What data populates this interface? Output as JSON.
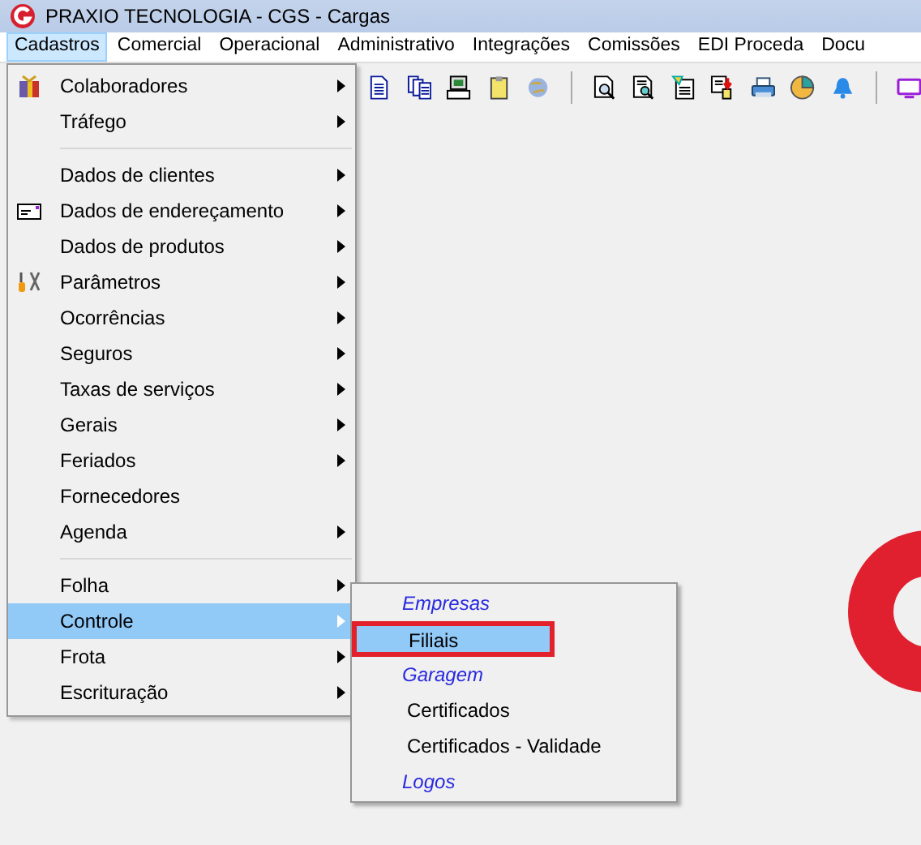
{
  "window": {
    "title": "PRAXIO TECNOLOGIA - CGS - Cargas"
  },
  "menu_bar": [
    {
      "label": "Cadastros",
      "selected": true
    },
    {
      "label": "Comercial",
      "selected": false
    },
    {
      "label": "Operacional",
      "selected": false
    },
    {
      "label": "Administrativo",
      "selected": false
    },
    {
      "label": "Integrações",
      "selected": false
    },
    {
      "label": "Comissões",
      "selected": false
    },
    {
      "label": "EDI Proceda",
      "selected": false
    },
    {
      "label": "Docu",
      "selected": false
    }
  ],
  "menu": [
    {
      "label": "Colaboradores",
      "submenu": true,
      "selected": false,
      "separator_after": false
    },
    {
      "label": "Tráfego",
      "submenu": true,
      "selected": false,
      "separator_after": true
    },
    {
      "label": "Dados de clientes",
      "submenu": true,
      "selected": false,
      "separator_after": false
    },
    {
      "label": "Dados de endereçamento",
      "submenu": true,
      "selected": false,
      "separator_after": false
    },
    {
      "label": "Dados de produtos",
      "submenu": true,
      "selected": false,
      "separator_after": false
    },
    {
      "label": "Parâmetros",
      "submenu": true,
      "selected": false,
      "separator_after": false
    },
    {
      "label": "Ocorrências",
      "submenu": true,
      "selected": false,
      "separator_after": false
    },
    {
      "label": "Seguros",
      "submenu": true,
      "selected": false,
      "separator_after": false
    },
    {
      "label": "Taxas de serviços",
      "submenu": true,
      "selected": false,
      "separator_after": false
    },
    {
      "label": "Gerais",
      "submenu": true,
      "selected": false,
      "separator_after": false
    },
    {
      "label": "Feriados",
      "submenu": true,
      "selected": false,
      "separator_after": false
    },
    {
      "label": "Fornecedores",
      "submenu": false,
      "selected": false,
      "separator_after": false
    },
    {
      "label": "Agenda",
      "submenu": true,
      "selected": false,
      "separator_after": true
    },
    {
      "label": "Folha",
      "submenu": true,
      "selected": false,
      "separator_after": false
    },
    {
      "label": "Controle",
      "submenu": true,
      "selected": true,
      "separator_after": false
    },
    {
      "label": "Frota",
      "submenu": true,
      "selected": false,
      "separator_after": false
    },
    {
      "label": "Escrituração",
      "submenu": true,
      "selected": false,
      "separator_after": false
    }
  ],
  "submenu": [
    {
      "kind": "group",
      "label": "Empresas"
    },
    {
      "kind": "item",
      "label": "Filiais",
      "selected": true,
      "highlighted": true
    },
    {
      "kind": "group",
      "label": "Garagem"
    },
    {
      "kind": "item",
      "label": "Certificados",
      "selected": false,
      "highlighted": false
    },
    {
      "kind": "item",
      "label": "Certificados - Validade",
      "selected": false,
      "highlighted": false
    },
    {
      "kind": "group",
      "label": "Logos"
    }
  ]
}
